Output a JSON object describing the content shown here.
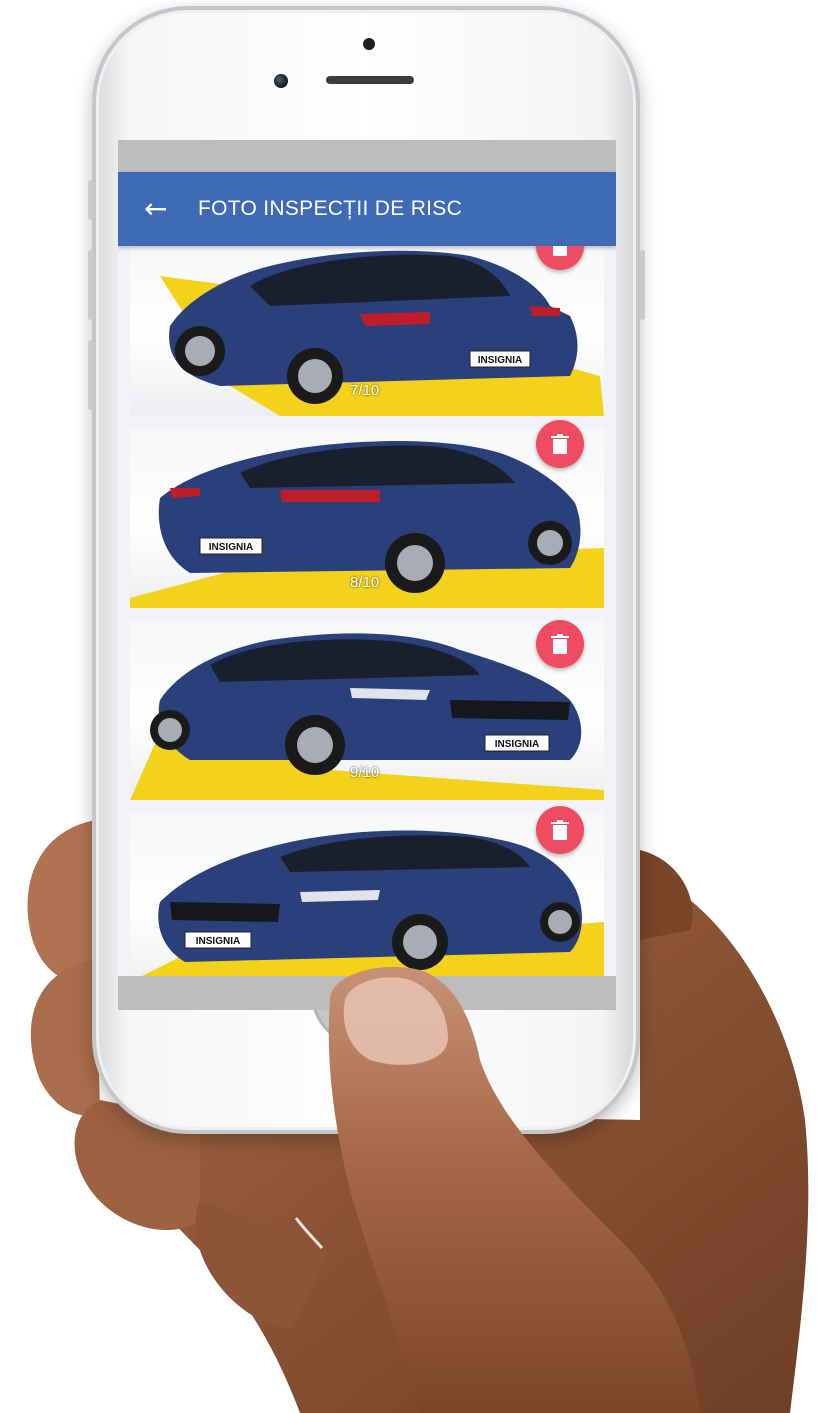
{
  "app_bar": {
    "back_icon": "arrow-left-icon",
    "title": "FOTO INSPECȚII DE RISC",
    "color": "#3f6ab5"
  },
  "photos": [
    {
      "counter": "7/10",
      "view": "rear-left",
      "plate": "INSIGNIA"
    },
    {
      "counter": "8/10",
      "view": "rear-right",
      "plate": "INSIGNIA"
    },
    {
      "counter": "9/10",
      "view": "front-right",
      "plate": "INSIGNIA"
    },
    {
      "counter": "",
      "view": "front-left",
      "plate": "INSIGNIA"
    }
  ],
  "colors": {
    "delete_button": "#ef4b63",
    "car_body": "#2b3f7a",
    "floor_accent": "#f2d21b"
  },
  "icons": {
    "delete": "trash-icon"
  }
}
